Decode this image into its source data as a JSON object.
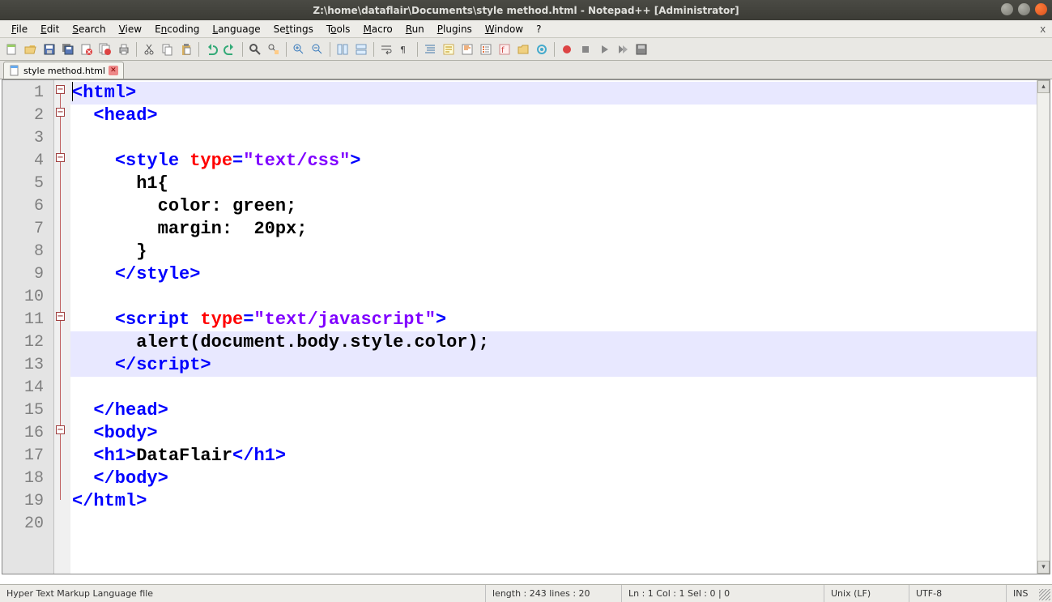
{
  "window": {
    "title": "Z:\\home\\dataflair\\Documents\\style method.html - Notepad++ [Administrator]"
  },
  "menu": {
    "file": "File",
    "edit": "Edit",
    "search": "Search",
    "view": "View",
    "encoding": "Encoding",
    "language": "Language",
    "settings": "Settings",
    "tools": "Tools",
    "macro": "Macro",
    "run": "Run",
    "plugins": "Plugins",
    "window": "Window",
    "help": "?"
  },
  "tab": {
    "filename": "style method.html"
  },
  "lines": [
    "1",
    "2",
    "3",
    "4",
    "5",
    "6",
    "7",
    "8",
    "9",
    "10",
    "11",
    "12",
    "13",
    "14",
    "15",
    "16",
    "17",
    "18",
    "19",
    "20"
  ],
  "code": {
    "l1": {
      "a": "<html>"
    },
    "l2": {
      "a": "<head>"
    },
    "l4": {
      "a": "<style",
      "b": " type",
      "c": "=",
      "d": "\"text/css\"",
      "e": ">"
    },
    "l5": {
      "a": "h1{"
    },
    "l6": {
      "a": "color: green;"
    },
    "l7": {
      "a": "margin:  20px;"
    },
    "l8": {
      "a": "}"
    },
    "l9": {
      "a": "</style>"
    },
    "l11": {
      "a": "<script",
      "b": " type",
      "c": "=",
      "d": "\"text/javascript\"",
      "e": ">"
    },
    "l12": {
      "a": "alert",
      "b": "(",
      "c": "document.body.style.color",
      "d": ");"
    },
    "l13": {
      "a": "</script>"
    },
    "l15": {
      "a": "</head>"
    },
    "l16": {
      "a": "<body>"
    },
    "l17": {
      "a": "<h1>",
      "b": "DataFlair",
      "c": "</h1>"
    },
    "l18": {
      "a": "</body>"
    },
    "l19": {
      "a": "</html>"
    }
  },
  "status": {
    "filetype": "Hyper Text Markup Language file",
    "length": "length : 243    lines : 20",
    "pos": "Ln : 1    Col : 1    Sel : 0 | 0",
    "eol": "Unix (LF)",
    "enc": "UTF-8",
    "mode": "INS"
  }
}
